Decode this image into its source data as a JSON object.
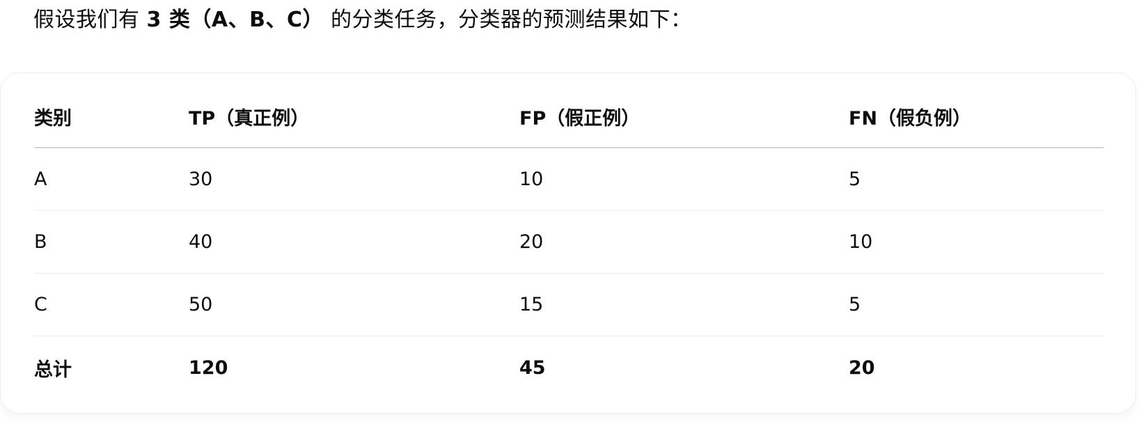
{
  "intro": {
    "prefix": "假设我们有 ",
    "bold": "3 类（A、B、C）",
    "suffix": " 的分类任务，分类器的预测结果如下："
  },
  "table": {
    "headers": [
      "类别",
      "TP（真正例）",
      "FP（假正例）",
      "FN（假负例）"
    ],
    "rows": [
      [
        "A",
        "30",
        "10",
        "5"
      ],
      [
        "B",
        "40",
        "20",
        "10"
      ],
      [
        "C",
        "50",
        "15",
        "5"
      ]
    ],
    "total": [
      "总计",
      "120",
      "45",
      "20"
    ]
  }
}
